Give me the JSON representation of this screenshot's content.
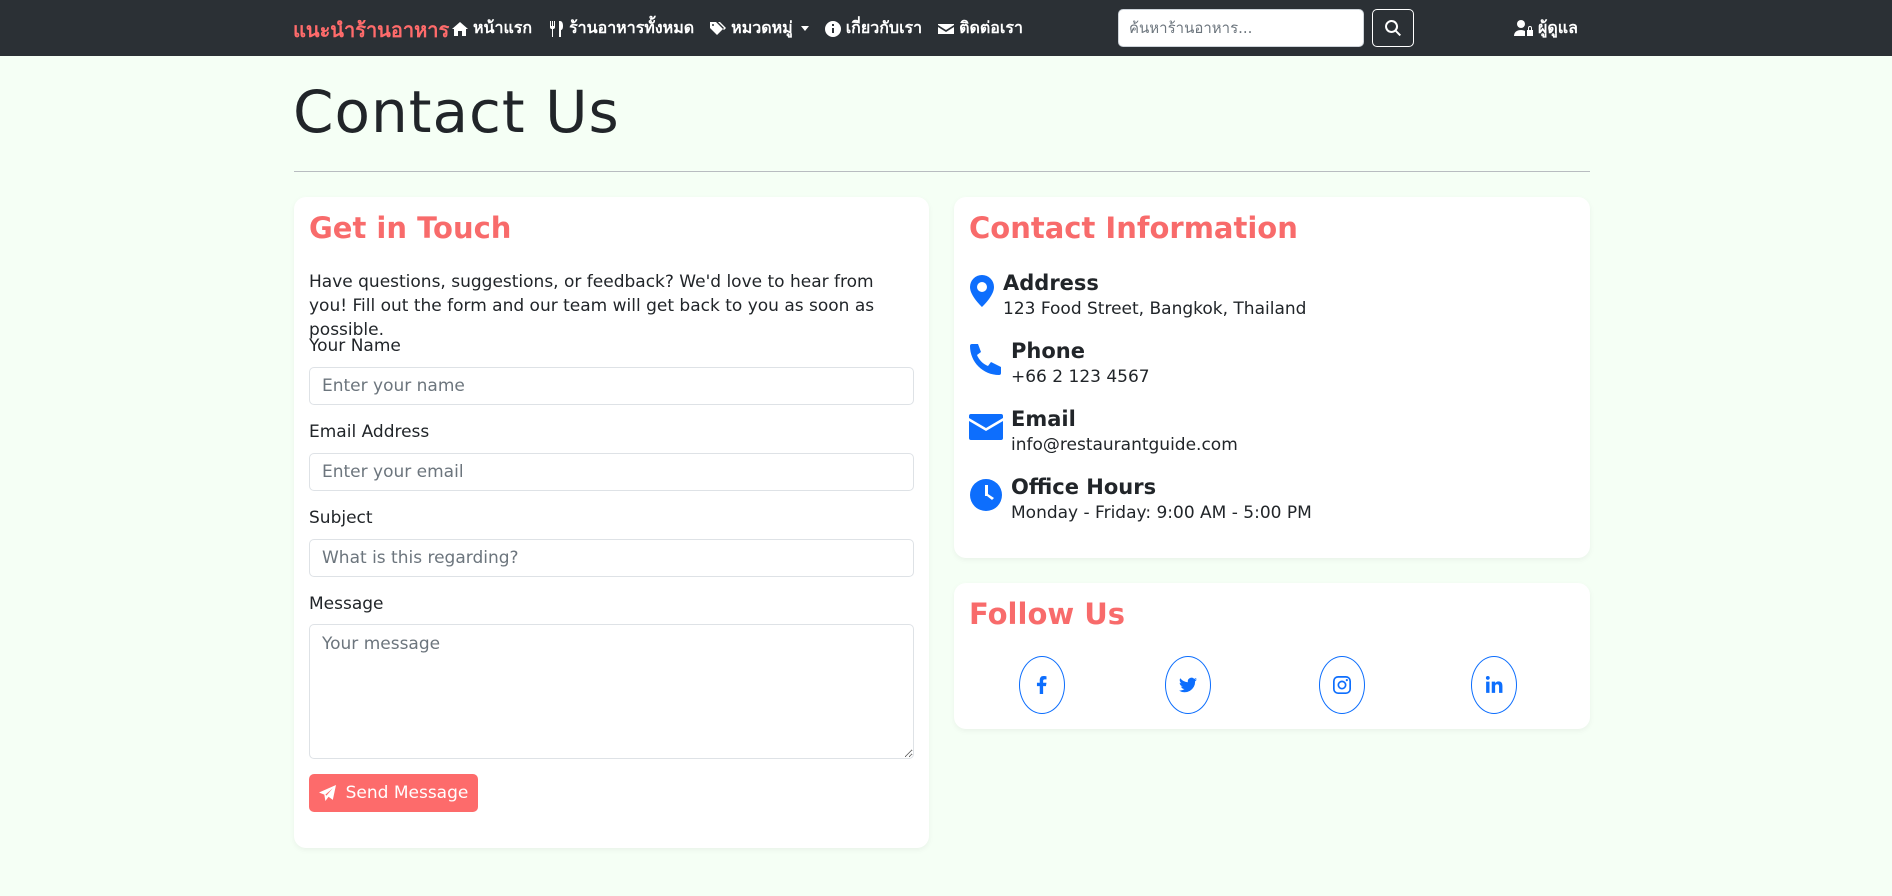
{
  "navbar": {
    "brand": "แนะนำร้านอาหาร",
    "links": [
      {
        "label": "หน้าแรก",
        "icon": "home-icon"
      },
      {
        "label": "ร้านอาหารทั้งหมด",
        "icon": "utensils-icon"
      },
      {
        "label": "หมวดหมู่",
        "icon": "tags-icon"
      },
      {
        "label": "เกี่ยวกับเรา",
        "icon": "info-circle-icon"
      },
      {
        "label": "ติดต่อเรา",
        "icon": "envelope-icon"
      }
    ],
    "search_placeholder": "ค้นหาร้านอาหาร...",
    "admin_label": "ผู้ดูแล"
  },
  "page": {
    "title": "Contact Us"
  },
  "form_card": {
    "title": "Get in Touch",
    "intro": "Have questions, suggestions, or feedback? We'd love to hear from you! Fill out the form and our team will get back to you as soon as possible.",
    "name_label": "Your Name",
    "name_placeholder": "Enter your name",
    "email_label": "Email Address",
    "email_placeholder": "Enter your email",
    "subject_label": "Subject",
    "subject_placeholder": "What is this regarding?",
    "message_label": "Message",
    "message_placeholder": "Your message",
    "send_label": "Send Message"
  },
  "info_card": {
    "title": "Contact Information",
    "items": [
      {
        "heading": "Address",
        "text": "123 Food Street, Bangkok, Thailand",
        "icon": "map-marker-icon"
      },
      {
        "heading": "Phone",
        "text": "+66 2 123 4567",
        "icon": "phone-icon"
      },
      {
        "heading": "Email",
        "text": "info@restaurantguide.com",
        "icon": "envelope-icon"
      },
      {
        "heading": "Office Hours",
        "text": "Monday - Friday: 9:00 AM - 5:00 PM",
        "icon": "clock-icon"
      }
    ]
  },
  "follow_card": {
    "title": "Follow Us",
    "socials": [
      "facebook-icon",
      "twitter-icon",
      "instagram-icon",
      "linkedin-icon"
    ]
  },
  "colors": {
    "brand": "#ff6b6b",
    "accent": "#0d6efd",
    "navbar": "#2b3035",
    "background": "#f5fff5"
  }
}
